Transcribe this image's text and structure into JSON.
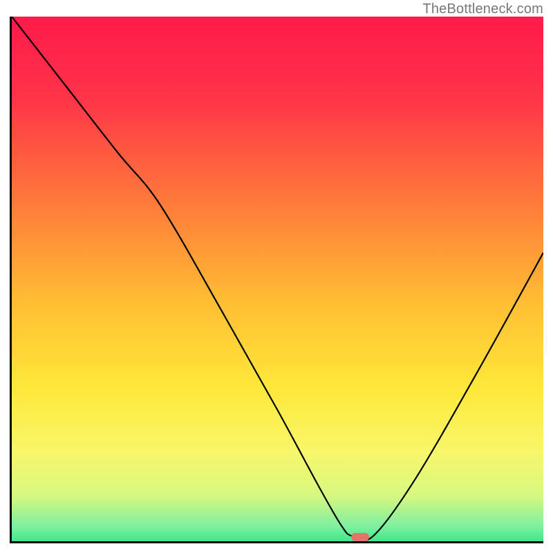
{
  "watermark": "TheBottleneck.com",
  "chart_data": {
    "type": "line",
    "title": "",
    "xlabel": "",
    "ylabel": "",
    "xlim": [
      0,
      100
    ],
    "ylim": [
      0,
      100
    ],
    "series": [
      {
        "name": "bottleneck-curve",
        "x": [
          0,
          10,
          20,
          28,
          40,
          50,
          58,
          62,
          64,
          68,
          76,
          88,
          100
        ],
        "y": [
          100,
          87,
          74,
          64,
          43,
          25,
          10,
          3,
          1,
          1,
          12,
          33,
          55
        ]
      }
    ],
    "gradient_stops": [
      {
        "offset": 0.0,
        "color": "#ff1a4b"
      },
      {
        "offset": 0.15,
        "color": "#ff3348"
      },
      {
        "offset": 0.35,
        "color": "#ff7a3a"
      },
      {
        "offset": 0.55,
        "color": "#ffc233"
      },
      {
        "offset": 0.7,
        "color": "#ffe83a"
      },
      {
        "offset": 0.82,
        "color": "#f7f76a"
      },
      {
        "offset": 0.9,
        "color": "#d8f881"
      },
      {
        "offset": 0.96,
        "color": "#7df0a0"
      },
      {
        "offset": 1.0,
        "color": "#20e37e"
      }
    ],
    "marker": {
      "x_pct": 65.5,
      "y_pct": 99.2,
      "color": "#e57368"
    }
  }
}
